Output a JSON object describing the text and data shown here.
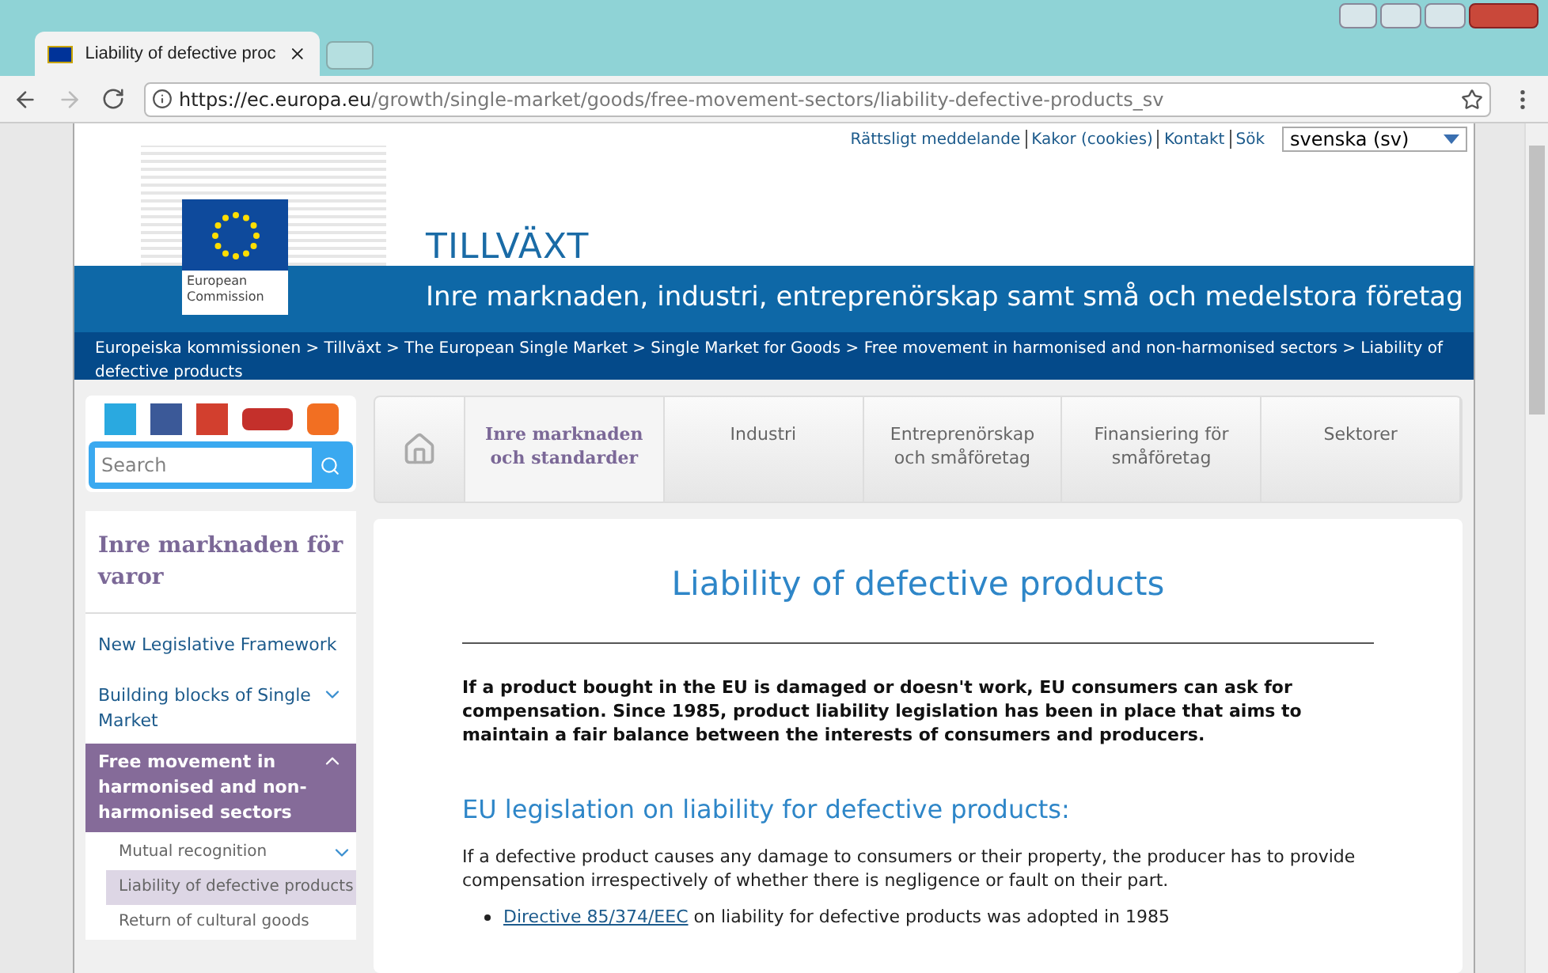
{
  "browser": {
    "tab_title": "Liability of defective proc",
    "url_host": "https://ec.europa.eu",
    "url_path": "/growth/single-market/goods/free-movement-sectors/liability-defective-products_sv"
  },
  "top_links": [
    "Rättsligt meddelande",
    "Kakor (cookies)",
    "Kontakt",
    "Sök"
  ],
  "language": "svenska (sv)",
  "logo": {
    "line1": "European",
    "line2": "Commission"
  },
  "site_title": "TILLVÄXT",
  "site_subtitle": "Inre marknaden, industri, entreprenörskap samt små och medelstora företag",
  "breadcrumb_separator": ">",
  "breadcrumb": [
    "Europeiska kommissionen",
    "Tillväxt",
    "The European Single Market",
    "Single Market for Goods",
    "Free movement in harmonised and non-harmonised sectors",
    "Liability of defective products"
  ],
  "search": {
    "placeholder": "Search"
  },
  "nav": [
    {
      "label": "Inre marknaden och standarder",
      "selected": true
    },
    {
      "label": "Industri",
      "selected": false
    },
    {
      "label": "Entreprenörskap och småföretag",
      "selected": false
    },
    {
      "label": "Finansiering för småföretag",
      "selected": false
    },
    {
      "label": "Sektorer",
      "selected": false
    }
  ],
  "sidebar": {
    "title": "Inre marknaden för varor",
    "items": [
      {
        "label": "New Legislative Framework",
        "selected": false
      },
      {
        "label": "Building blocks of Single Market",
        "expanded": false,
        "selected": false,
        "has_children": true
      },
      {
        "label": "Free movement in harmonised and non-harmonised sectors",
        "expanded": true,
        "selected": true,
        "has_children": true,
        "children": [
          {
            "label": "Mutual recognition",
            "selected": false,
            "has_children": true
          },
          {
            "label": "Liability of defective products",
            "selected": true
          },
          {
            "label": "Return of cultural goods",
            "selected": false
          }
        ]
      }
    ]
  },
  "article": {
    "title": "Liability of defective products",
    "lead": "If a product bought in the EU is damaged or doesn't work, EU consumers can ask for compensation. Since 1985, product liability legislation has been in place that aims to maintain a fair balance between the interests of consumers and producers.",
    "heading": "EU legislation on liability for defective products:",
    "paragraph": "If a defective product causes any damage to consumers or their property, the producer has to provide compensation irrespectively of whether there is negligence or fault on their part.",
    "bullets": [
      {
        "link": "Directive 85/374/EEC",
        "text": "on liability for defective products was adopted in 1985"
      }
    ]
  }
}
